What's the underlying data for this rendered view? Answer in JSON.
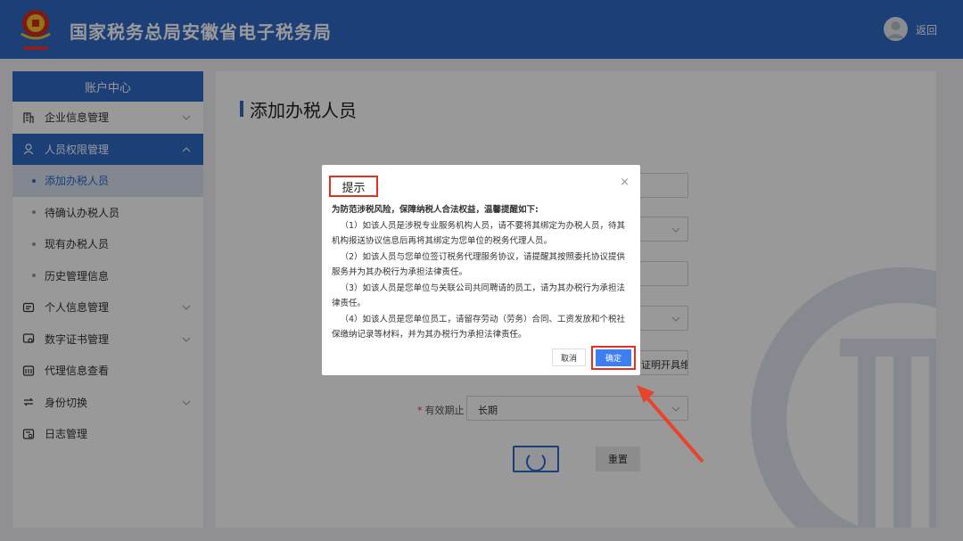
{
  "header": {
    "title": "国家税务总局安徽省电子税务局",
    "back_label": "返回",
    "brand_color": "#2f69c8"
  },
  "sidebar": {
    "heading": "账户中心",
    "items": [
      {
        "label": "企业信息管理",
        "icon": "building-icon",
        "expandable": true
      },
      {
        "label": "人员权限管理",
        "icon": "user-group-icon",
        "expandable": true,
        "active": true
      },
      {
        "label": "个人信息管理",
        "icon": "id-card-icon",
        "expandable": true
      },
      {
        "label": "数字证书管理",
        "icon": "certificate-icon",
        "expandable": true
      },
      {
        "label": "代理信息查看",
        "icon": "agent-icon",
        "expandable": false
      },
      {
        "label": "身份切换",
        "icon": "switch-icon",
        "expandable": true
      },
      {
        "label": "日志管理",
        "icon": "log-icon",
        "expandable": false
      }
    ],
    "sub_items": [
      {
        "label": "添加办税人员",
        "active": true
      },
      {
        "label": "待确认办税人员"
      },
      {
        "label": "现有办税人员"
      },
      {
        "label": "历史管理信息"
      }
    ]
  },
  "main": {
    "page_title": "添加办税人员",
    "form": {
      "partial_select_value": "证明开具维",
      "validity_label": "有效期止",
      "validity_value": "长期",
      "reset_label": "重置"
    }
  },
  "dialog": {
    "title": "提示",
    "close": "×",
    "lead": "为防范涉税风险，保障纳税人合法权益，温馨提醒如下:",
    "paragraphs": [
      "（1）如该人员是涉税专业服务机构人员，请不要将其绑定为办税人员，待其机构报送协议信息后再将其绑定为您单位的税务代理人员。",
      "（2）如该人员与您单位签订税务代理服务协议，请提醒其按照委托协议提供服务并为其办税行为承担法律责任。",
      "（3）如该人员是您单位与关联公司共同聘请的员工，请为其办税行为承担法律责任。",
      "（4）如该人员是您单位员工，请留存劳动（劳务）合同、工资发放和个税社保缴纳记录等材料，并为其办税行为承担法律责任。"
    ],
    "cancel_label": "取消",
    "ok_label": "确定",
    "highlight_color": "#e0321f"
  }
}
